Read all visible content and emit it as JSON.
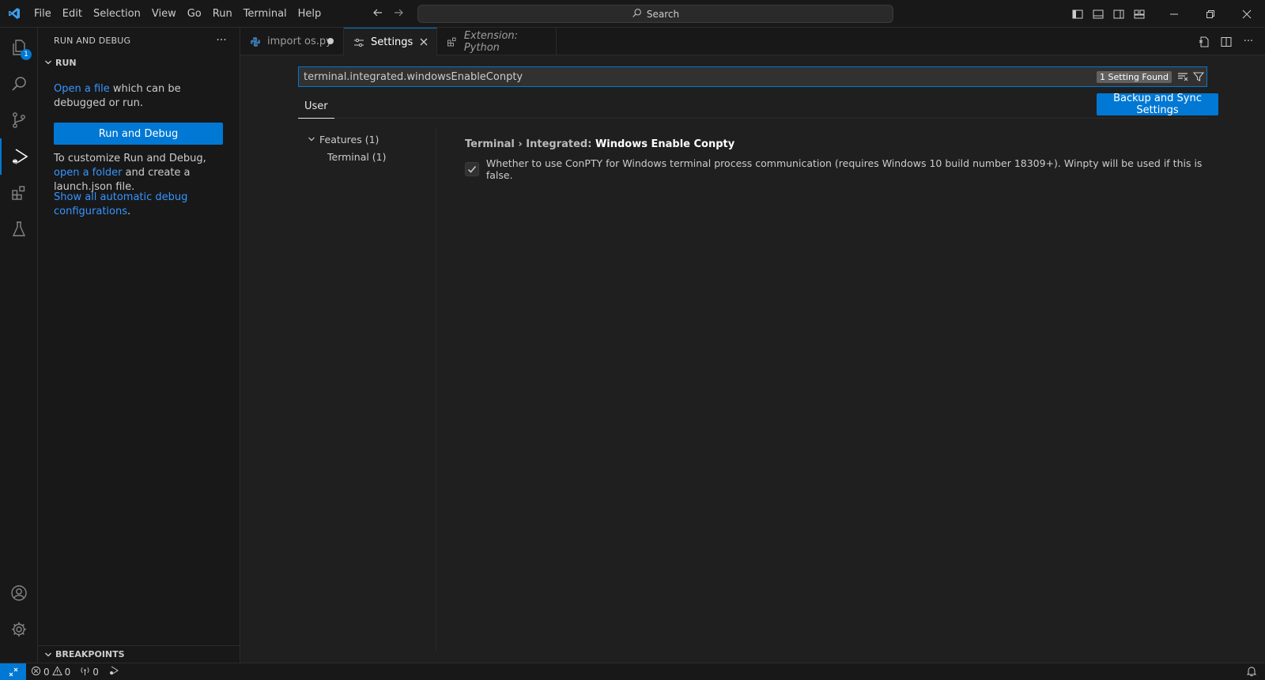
{
  "menu": [
    "File",
    "Edit",
    "Selection",
    "View",
    "Go",
    "Run",
    "Terminal",
    "Help"
  ],
  "command_center": {
    "placeholder": "Search"
  },
  "activity": {
    "explorer_badge": "1"
  },
  "sidebar": {
    "title": "RUN AND DEBUG",
    "run_section": "RUN",
    "open_file_link": "Open a file",
    "open_file_rest": " which can be debugged or run.",
    "run_button": "Run and Debug",
    "customize_prefix": "To customize Run and Debug, ",
    "open_folder_link": "open a folder",
    "customize_suffix": " and create a launch.json file.",
    "show_all_link": "Show all automatic debug configurations",
    "show_all_suffix": ".",
    "breakpoints_section": "BREAKPOINTS"
  },
  "tabs": [
    {
      "label": "import os.py",
      "italic": false
    },
    {
      "label": "Settings",
      "italic": false
    },
    {
      "label": "Extension: Python",
      "italic": true
    }
  ],
  "settings": {
    "search_value": "terminal.integrated.windowsEnableConpty",
    "found_label": "1 Setting Found",
    "scope_tab": "User",
    "sync_button": "Backup and Sync Settings",
    "toc": [
      {
        "label": "Features (1)"
      },
      {
        "label": "Terminal (1)"
      }
    ],
    "setting_category": "Terminal › Integrated: ",
    "setting_key": "Windows Enable Conpty",
    "setting_checked": true,
    "setting_description": "Whether to use ConPTY for Windows terminal process communication (requires Windows 10 build number 18309+). Winpty will be used if this is false."
  },
  "status": {
    "errors": "0",
    "warnings": "0",
    "ports": "0"
  },
  "colors": {
    "accent": "#0078d4",
    "link": "#3794ff",
    "background": "#1f1f1f",
    "chrome": "#181818"
  }
}
